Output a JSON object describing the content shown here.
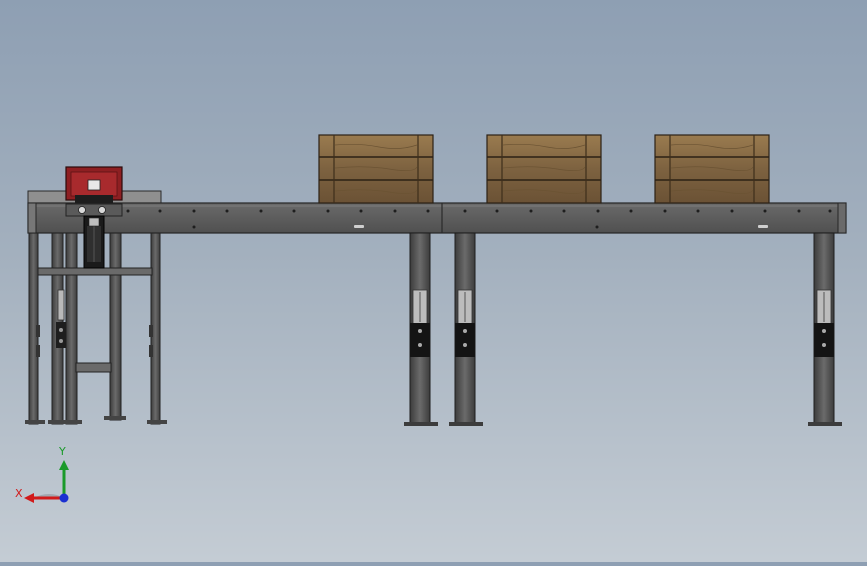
{
  "colors": {
    "background_top": "#8e9fb3",
    "background_bottom": "#c4ccd4",
    "frame_steel": "#5d5d5d",
    "frame_dark": "#2e2e2e",
    "frame_light": "#8a8a8a",
    "crate_wood": "#8a6d45",
    "crate_wood_dark": "#4b3a22",
    "motor_red": "#8e1f22",
    "axis_x": "#d11a1a",
    "axis_y": "#1a9a2a",
    "axis_z": "#1a2fd1"
  },
  "scene": {
    "description_items": [
      "conveyor-beam",
      "crate",
      "drive-unit",
      "support-leg",
      "axis-triad"
    ]
  },
  "triad": {
    "x_label": "X",
    "y_label": "Y",
    "x_icon": "axis-x-arrow-icon",
    "y_icon": "axis-y-arrow-icon",
    "z_icon": "axis-z-dot-icon"
  }
}
